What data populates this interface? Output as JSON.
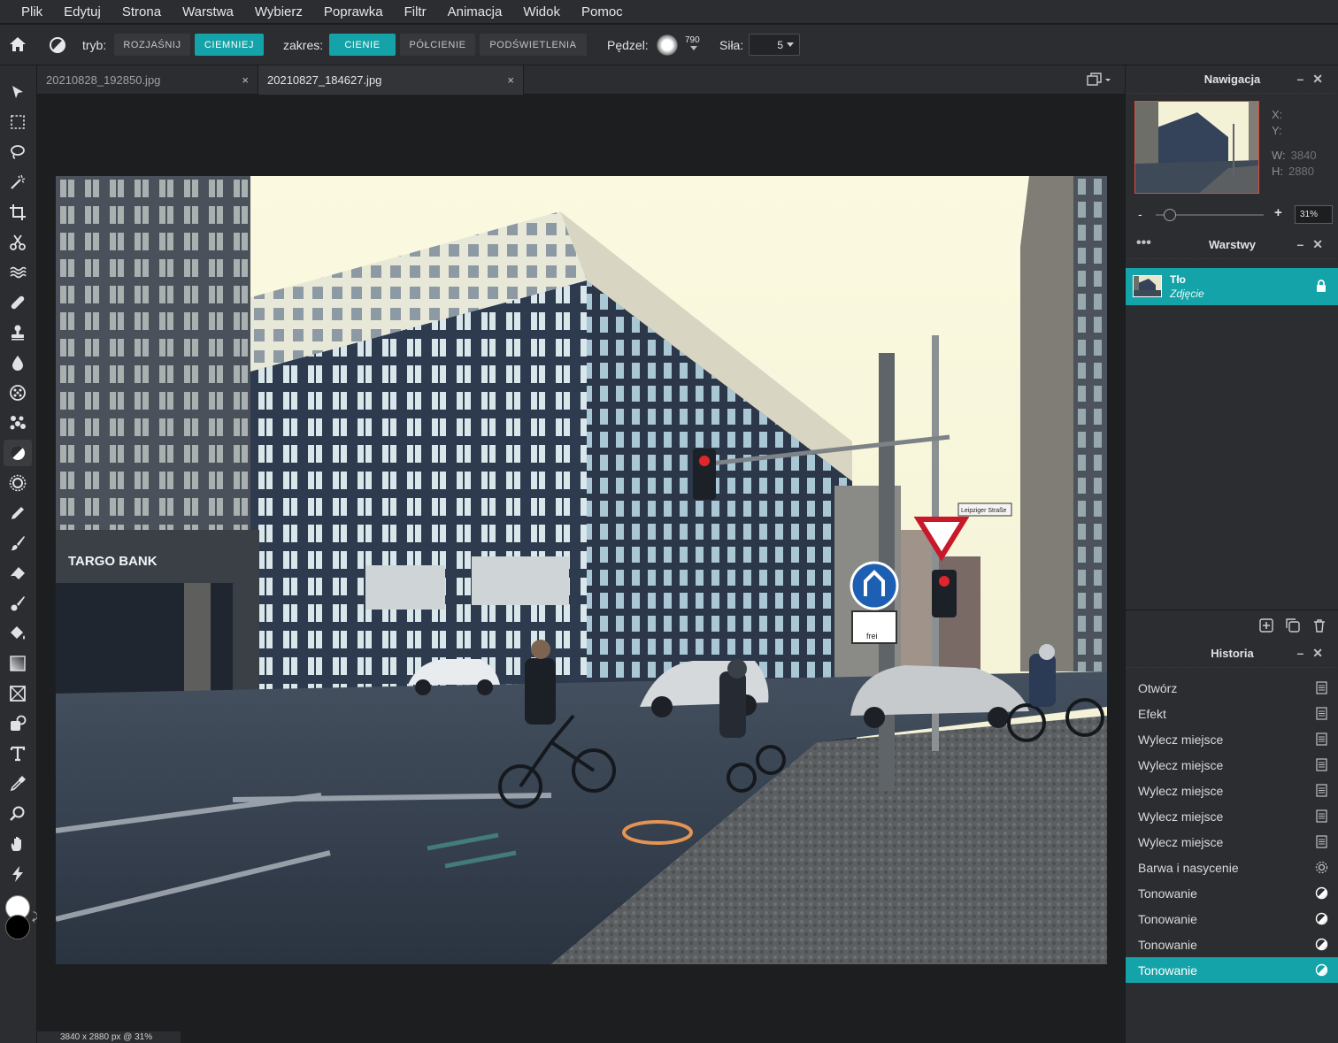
{
  "menu": [
    "Plik",
    "Edytuj",
    "Strona",
    "Warstwa",
    "Wybierz",
    "Poprawka",
    "Filtr",
    "Animacja",
    "Widok",
    "Pomoc"
  ],
  "options": {
    "mode_label": "tryb:",
    "mode_lighten": "ROZJAŚNIJ",
    "mode_darken": "CIEMNIEJ",
    "range_label": "zakres:",
    "range_shadows": "CIENIE",
    "range_midtones": "PÓŁCIENIE",
    "range_highlights": "PODŚWIETLENIA",
    "brush_label": "Pędzel:",
    "brush_size": "790",
    "strength_label": "Siła:",
    "strength_value": "5"
  },
  "tabs": [
    {
      "label": "20210828_192850.jpg",
      "close": "×",
      "active": false
    },
    {
      "label": "20210827_184627.jpg",
      "close": "×",
      "active": true
    }
  ],
  "status": "3840 x 2880 px @ 31%",
  "navigation": {
    "title": "Nawigacja",
    "x_label": "X:",
    "y_label": "Y:",
    "w_label": "W:",
    "w_value": "3840",
    "h_label": "H:",
    "h_value": "2880",
    "zoom_minus": "-",
    "zoom_plus": "+",
    "zoom_value": "31%",
    "zoom_level": 0.31
  },
  "layers": {
    "title": "Warstwy",
    "items": [
      {
        "name": "Tło",
        "type": "Zdjęcie",
        "locked": true
      }
    ]
  },
  "history": {
    "title": "Historia",
    "items": [
      {
        "label": "Otwórz",
        "icon": "doc-icon"
      },
      {
        "label": "Efekt",
        "icon": "doc-icon"
      },
      {
        "label": "Wylecz miejsce",
        "icon": "doc-icon"
      },
      {
        "label": "Wylecz miejsce",
        "icon": "doc-icon"
      },
      {
        "label": "Wylecz miejsce",
        "icon": "doc-icon"
      },
      {
        "label": "Wylecz miejsce",
        "icon": "doc-icon"
      },
      {
        "label": "Wylecz miejsce",
        "icon": "doc-icon"
      },
      {
        "label": "Barwa i nasycenie",
        "icon": "gear-icon"
      },
      {
        "label": "Tonowanie",
        "icon": "dodge-burn-icon"
      },
      {
        "label": "Tonowanie",
        "icon": "dodge-burn-icon"
      },
      {
        "label": "Tonowanie",
        "icon": "dodge-burn-icon"
      },
      {
        "label": "Tonowanie",
        "icon": "dodge-burn-icon",
        "active": true
      }
    ]
  },
  "photo_signs": {
    "bank": "TARGO BANK",
    "street": "Leipziger Straße",
    "bike_sign": "frei"
  },
  "colors": {
    "accent": "#14a3a8",
    "panel": "#2b2d30",
    "workspace": "#1d1e20",
    "foreground": "#ffffff",
    "background": "#000000"
  }
}
